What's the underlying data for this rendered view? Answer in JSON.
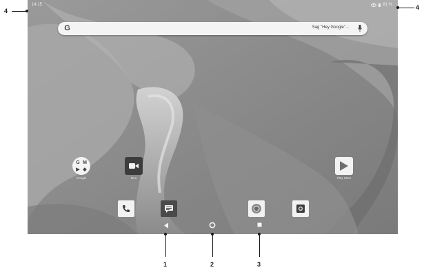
{
  "status_bar": {
    "time": "14:15",
    "battery": "81 %"
  },
  "search": {
    "logo": "G",
    "placeholder": "Sag \"Hey Google\"…"
  },
  "apps": {
    "google_folder": {
      "label": "Google",
      "mini_icons": [
        "G",
        "M",
        "▶",
        "◆"
      ]
    },
    "duo": {
      "label": "Duo"
    },
    "play_store": {
      "label": "Play Store"
    }
  },
  "dock": {
    "icons": [
      "phone-icon",
      "messages-icon",
      "chrome-icon",
      "camera-icon"
    ]
  },
  "annotations": {
    "labels": [
      "1",
      "2",
      "3",
      "4",
      "4"
    ]
  },
  "colors": {
    "screen_bg": "#8e8e8e",
    "icon_bg": "#f2f2f2",
    "duo_bg": "#3d3d3d",
    "messages_bg": "#4a4a4a"
  }
}
